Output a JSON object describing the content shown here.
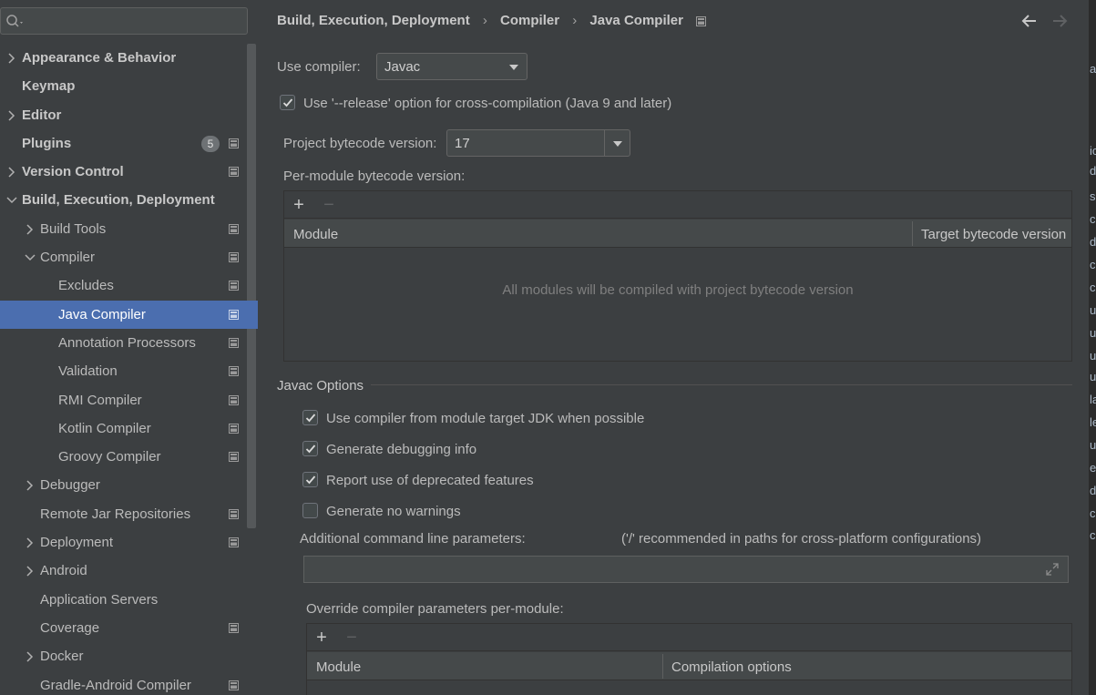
{
  "search": {
    "placeholder": "Q▾"
  },
  "sidebar": {
    "items": [
      {
        "label": "Appearance & Behavior",
        "level": 0,
        "arrow": "right",
        "bold": true,
        "project": false
      },
      {
        "label": "Keymap",
        "level": 0,
        "arrow": "",
        "bold": true,
        "project": false
      },
      {
        "label": "Editor",
        "level": 0,
        "arrow": "right",
        "bold": true,
        "project": false
      },
      {
        "label": "Plugins",
        "level": 0,
        "arrow": "",
        "bold": true,
        "project": true,
        "badge": "5"
      },
      {
        "label": "Version Control",
        "level": 0,
        "arrow": "right",
        "bold": true,
        "project": true
      },
      {
        "label": "Build, Execution, Deployment",
        "level": 0,
        "arrow": "down",
        "bold": true,
        "project": false
      },
      {
        "label": "Build Tools",
        "level": 1,
        "arrow": "right",
        "bold": false,
        "project": true
      },
      {
        "label": "Compiler",
        "level": 1,
        "arrow": "down",
        "bold": false,
        "project": true
      },
      {
        "label": "Excludes",
        "level": 2,
        "arrow": "",
        "bold": false,
        "project": true
      },
      {
        "label": "Java Compiler",
        "level": 2,
        "arrow": "",
        "bold": false,
        "project": true,
        "selected": true
      },
      {
        "label": "Annotation Processors",
        "level": 2,
        "arrow": "",
        "bold": false,
        "project": true
      },
      {
        "label": "Validation",
        "level": 2,
        "arrow": "",
        "bold": false,
        "project": true
      },
      {
        "label": "RMI Compiler",
        "level": 2,
        "arrow": "",
        "bold": false,
        "project": true
      },
      {
        "label": "Kotlin Compiler",
        "level": 2,
        "arrow": "",
        "bold": false,
        "project": true
      },
      {
        "label": "Groovy Compiler",
        "level": 2,
        "arrow": "",
        "bold": false,
        "project": true
      },
      {
        "label": "Debugger",
        "level": 1,
        "arrow": "right",
        "bold": false,
        "project": false
      },
      {
        "label": "Remote Jar Repositories",
        "level": 1,
        "arrow": "",
        "bold": false,
        "project": true
      },
      {
        "label": "Deployment",
        "level": 1,
        "arrow": "right",
        "bold": false,
        "project": true
      },
      {
        "label": "Android",
        "level": 1,
        "arrow": "right",
        "bold": false,
        "project": false
      },
      {
        "label": "Application Servers",
        "level": 1,
        "arrow": "",
        "bold": false,
        "project": false
      },
      {
        "label": "Coverage",
        "level": 1,
        "arrow": "",
        "bold": false,
        "project": true
      },
      {
        "label": "Docker",
        "level": 1,
        "arrow": "right",
        "bold": false,
        "project": false
      },
      {
        "label": "Gradle-Android Compiler",
        "level": 1,
        "arrow": "",
        "bold": false,
        "project": true
      }
    ]
  },
  "breadcrumb": {
    "items": [
      "Build, Execution, Deployment",
      "Compiler",
      "Java Compiler"
    ]
  },
  "compiler": {
    "use_compiler_label": "Use compiler:",
    "use_compiler_value": "Javac",
    "release_option_label": "Use '--release' option for cross-compilation (Java 9 and later)",
    "release_option_checked": true,
    "project_bytecode_label": "Project bytecode version:",
    "project_bytecode_value": "17",
    "per_module_label": "Per-module bytecode version:",
    "per_module_table": {
      "col_module": "Module",
      "col_target": "Target bytecode version",
      "empty_text": "All modules will be compiled with project bytecode version"
    }
  },
  "javac": {
    "section_title": "Javac Options",
    "options": [
      {
        "label": "Use compiler from module target JDK when possible",
        "checked": true
      },
      {
        "label": "Generate debugging info",
        "checked": true
      },
      {
        "label": "Report use of deprecated features",
        "checked": true
      },
      {
        "label": "Generate no warnings",
        "checked": false
      }
    ],
    "additional_params_label": "Additional command line parameters:",
    "additional_params_hint": "('/' recommended in paths for cross-platform configurations)",
    "additional_params_value": "",
    "override_label": "Override compiler parameters per-module:",
    "override_table": {
      "col_module": "Module",
      "col_options": "Compilation options"
    }
  },
  "toolbar": {
    "add": "+",
    "remove": "−"
  },
  "edge_fragments": [
    "a",
    "ic",
    "d",
    "s",
    "c",
    "d",
    "c",
    "c",
    "u",
    "u",
    "u",
    "u",
    "la",
    "le",
    "u",
    "es",
    "d",
    "c",
    "c"
  ]
}
